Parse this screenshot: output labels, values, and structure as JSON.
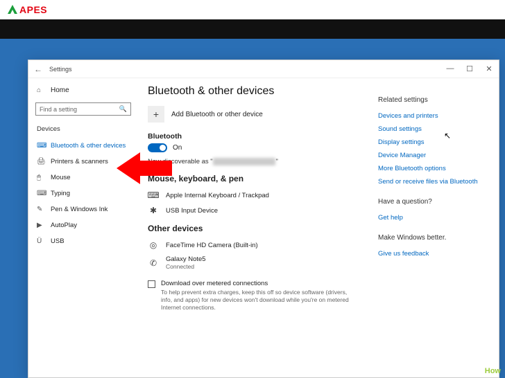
{
  "brand": "APES",
  "window": {
    "title": "Settings"
  },
  "sidebar": {
    "home": "Home",
    "search_placeholder": "Find a setting",
    "category": "Devices",
    "items": [
      {
        "label": "Bluetooth & other devices"
      },
      {
        "label": "Printers & scanners"
      },
      {
        "label": "Mouse"
      },
      {
        "label": "Typing"
      },
      {
        "label": "Pen & Windows Ink"
      },
      {
        "label": "AutoPlay"
      },
      {
        "label": "USB"
      }
    ]
  },
  "page": {
    "title": "Bluetooth & other devices",
    "add_label": "Add Bluetooth or other device",
    "bt_heading": "Bluetooth",
    "bt_state": "On",
    "discover_prefix": "Now discoverable as ",
    "discover_name": "REDACTED-DEVICE",
    "mkp_heading": "Mouse, keyboard, & pen",
    "dev1": "Apple Internal Keyboard / Trackpad",
    "dev2": "USB Input Device",
    "other_heading": "Other devices",
    "dev3": "FaceTime HD Camera (Built-in)",
    "dev4": "Galaxy Note5",
    "dev4_sub": "Connected",
    "dl_label": "Download over metered connections",
    "dl_desc": "To help prevent extra charges, keep this off so device software (drivers, info, and apps) for new devices won't download while you're on metered Internet connections."
  },
  "right": {
    "related": "Related settings",
    "links1": [
      "Devices and printers",
      "Sound settings",
      "Display settings",
      "Device Manager",
      "More Bluetooth options",
      "Send or receive files via Bluetooth"
    ],
    "question": "Have a question?",
    "help": "Get help",
    "better": "Make Windows better.",
    "feedback": "Give us feedback"
  },
  "watermark": "wikiHow"
}
